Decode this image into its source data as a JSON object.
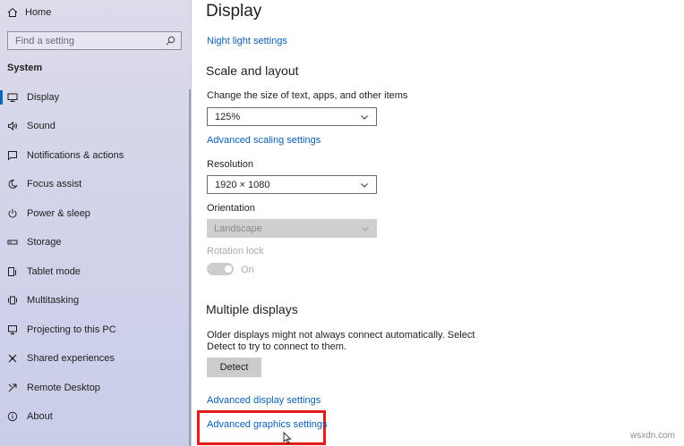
{
  "sidebar": {
    "home_label": "Home",
    "search_placeholder": "Find a setting",
    "section_label": "System",
    "items": [
      {
        "label": "Display",
        "icon": "monitor-icon"
      },
      {
        "label": "Sound",
        "icon": "speaker-icon"
      },
      {
        "label": "Notifications & actions",
        "icon": "notification-icon"
      },
      {
        "label": "Focus assist",
        "icon": "moon-icon"
      },
      {
        "label": "Power & sleep",
        "icon": "power-icon"
      },
      {
        "label": "Storage",
        "icon": "storage-icon"
      },
      {
        "label": "Tablet mode",
        "icon": "tablet-icon"
      },
      {
        "label": "Multitasking",
        "icon": "multitasking-icon"
      },
      {
        "label": "Projecting to this PC",
        "icon": "projecting-icon"
      },
      {
        "label": "Shared experiences",
        "icon": "shared-icon"
      },
      {
        "label": "Remote Desktop",
        "icon": "remote-icon"
      },
      {
        "label": "About",
        "icon": "info-icon"
      }
    ],
    "active_item": "Display"
  },
  "main": {
    "title": "Display",
    "night_light_link": "Night light settings",
    "scale_section": {
      "title": "Scale and layout",
      "scale_label": "Change the size of text, apps, and other items",
      "scale_value": "125%",
      "advanced_scaling_link": "Advanced scaling settings",
      "resolution_label": "Resolution",
      "resolution_value": "1920 × 1080",
      "orientation_label": "Orientation",
      "orientation_value": "Landscape",
      "rotation_lock_label": "Rotation lock",
      "rotation_lock_state": "On"
    },
    "multiple_displays": {
      "title": "Multiple displays",
      "description": "Older displays might not always connect automatically. Select Detect to try to connect to them.",
      "detect_button": "Detect",
      "advanced_display_link": "Advanced display settings",
      "advanced_graphics_link": "Advanced graphics settings"
    }
  },
  "watermark": "wsxdn.com",
  "colors": {
    "link": "#0a5fb4",
    "highlight": "#e31b1b",
    "accent": "#0067c0"
  }
}
